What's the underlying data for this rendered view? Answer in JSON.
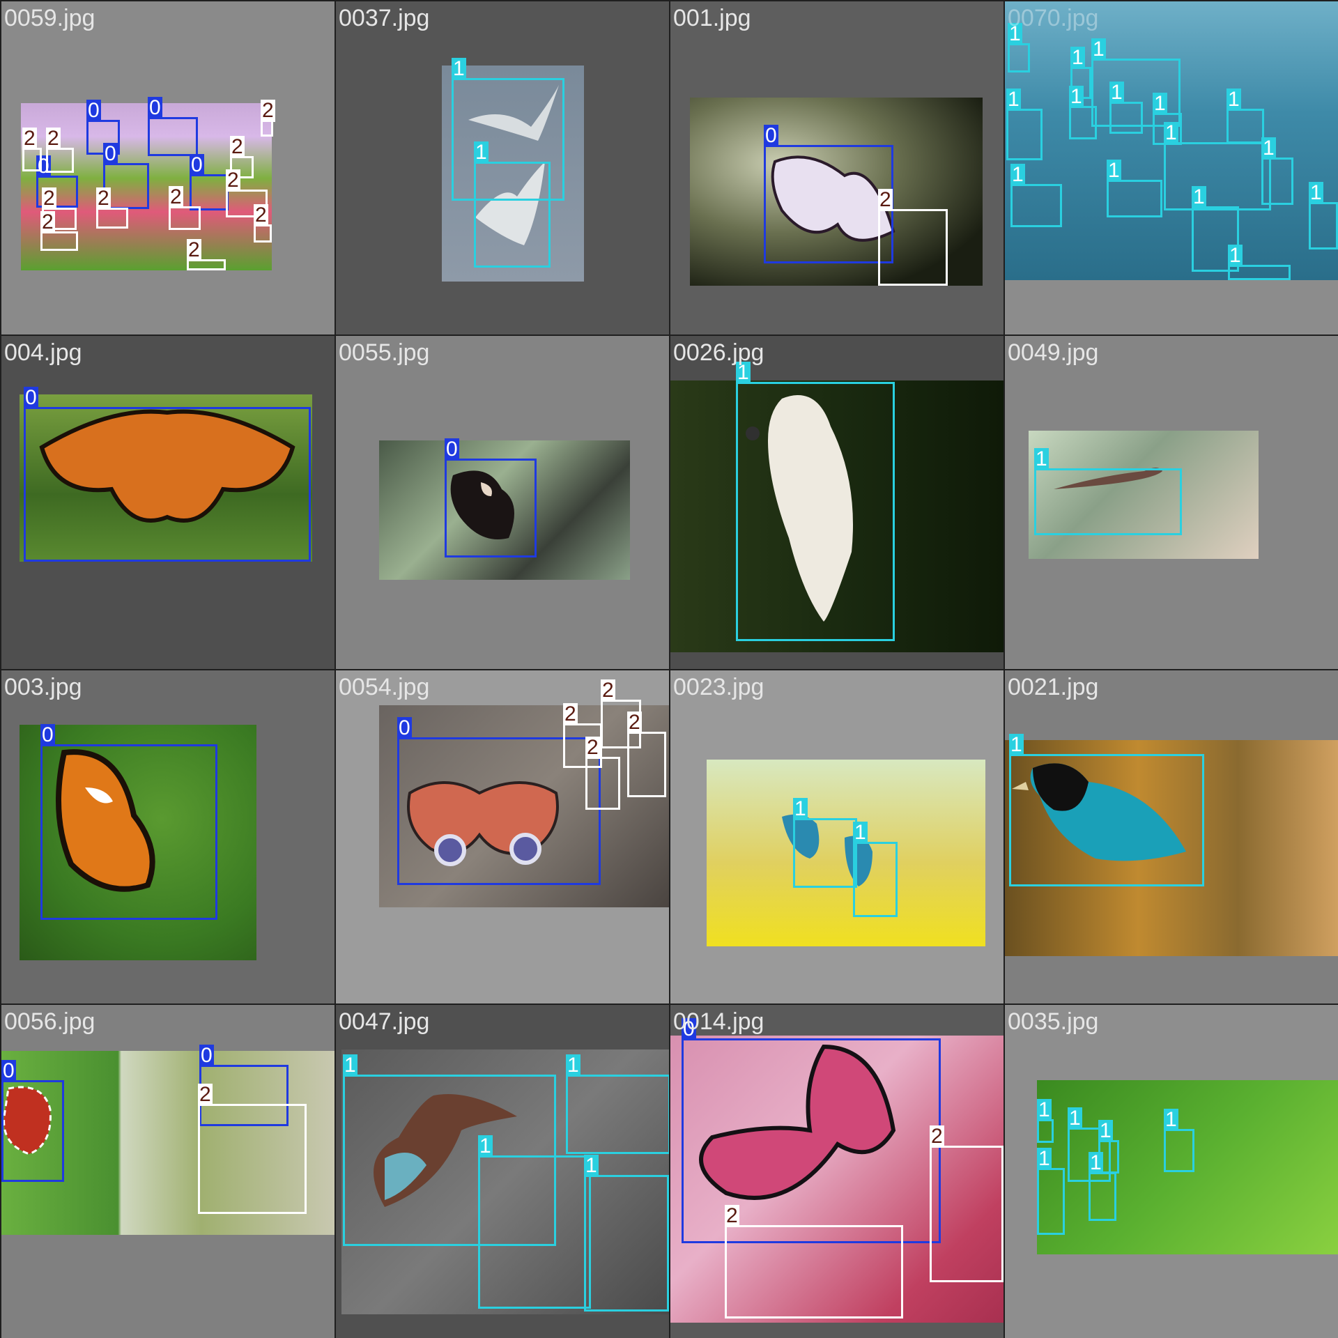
{
  "class_colors": {
    "0": "#1f3ae0",
    "1": "#2ad0e0",
    "2": "#ffffff"
  },
  "tiles": [
    {
      "file": "0059.jpg"
    },
    {
      "file": "0037.jpg"
    },
    {
      "file": "001.jpg"
    },
    {
      "file": "0070.jpg"
    },
    {
      "file": "004.jpg"
    },
    {
      "file": "0055.jpg"
    },
    {
      "file": "0026.jpg"
    },
    {
      "file": "0049.jpg"
    },
    {
      "file": "003.jpg"
    },
    {
      "file": "0054.jpg"
    },
    {
      "file": "0023.jpg"
    },
    {
      "file": "0021.jpg"
    },
    {
      "file": "0056.jpg"
    },
    {
      "file": "0047.jpg"
    },
    {
      "file": "0014.jpg"
    },
    {
      "file": "0035.jpg"
    }
  ],
  "labels": {
    "c0": "0",
    "c1": "1",
    "c2": "2"
  }
}
